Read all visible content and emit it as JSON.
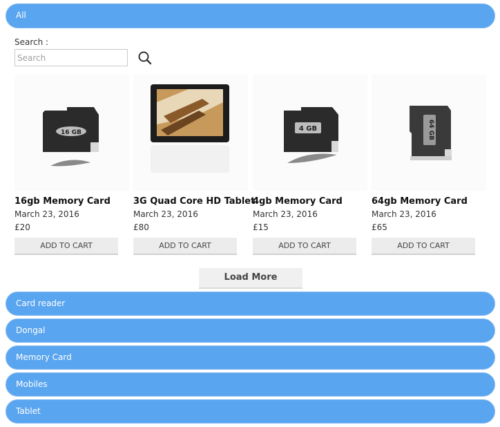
{
  "categories": {
    "all": "All",
    "items": [
      {
        "label": "Card reader"
      },
      {
        "label": "Dongal"
      },
      {
        "label": "Memory Card"
      },
      {
        "label": "Mobiles"
      },
      {
        "label": "Tablet"
      }
    ]
  },
  "search": {
    "label": "Search :",
    "placeholder": "Search",
    "value": ""
  },
  "products": [
    {
      "name": "16gb Memory Card",
      "date": "March 23, 2016",
      "price": "£20",
      "button": "ADD TO CART",
      "card_label": "16 GB"
    },
    {
      "name": "3G Quad Core HD Tablet",
      "date": "March 23, 2016",
      "price": "£80",
      "button": "ADD TO CART"
    },
    {
      "name": "4gb Memory Card",
      "date": "March 23, 2016",
      "price": "£15",
      "button": "ADD TO CART",
      "card_label": "4 GB"
    },
    {
      "name": "64gb Memory Card",
      "date": "March 23, 2016",
      "price": "£65",
      "button": "ADD TO CART",
      "card_label": "64 GB"
    }
  ],
  "load_more": "Load More",
  "colors": {
    "category_bar": "#5aa5ef",
    "button": "#ececec"
  }
}
